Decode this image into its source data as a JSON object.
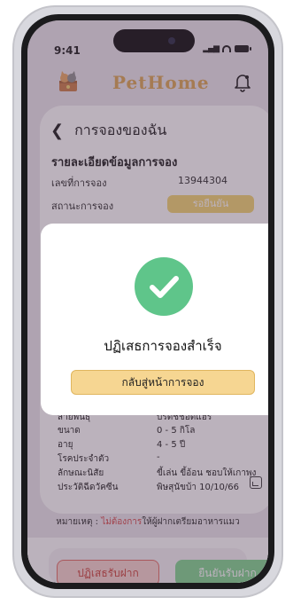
{
  "status_bar": {
    "time": "9:41"
  },
  "header": {
    "brand": "PetHome"
  },
  "booking": {
    "page_title": "การจองของฉัน",
    "section_title": "รายละเอียดข้อมูลการจอง",
    "rows": [
      {
        "label": "เลขที่การจอง",
        "value": "13944304"
      },
      {
        "label": "สถานะการจอง",
        "value": "รอยืนยัน"
      }
    ]
  },
  "pet": {
    "rows": [
      {
        "label": "สายพันธุ์",
        "value": "บริติชช็อตแฮร์"
      },
      {
        "label": "ขนาด",
        "value": "0 - 5 กิโล"
      },
      {
        "label": "อายุ",
        "value": "4 - 5 ปี"
      },
      {
        "label": "โรคประจำตัว",
        "value": "-"
      },
      {
        "label": "ลักษณะนิสัย",
        "value": "ขี้เล่น ขี้อ้อน ชอบให้เกาพุง"
      },
      {
        "label": "ประวัติฉีดวัคซีน",
        "value": "พิษสุนัขบ้า  10/10/66"
      }
    ],
    "vaccine_icon": "document-icon"
  },
  "remark": {
    "prefix": "หมายเหตุ : ",
    "highlight": "ไม่ต้องการ",
    "suffix": "ให้ผู้ฝากเตรียมอาหารแมว"
  },
  "actions": {
    "reject_label": "ปฏิเสธรับฝาก",
    "accept_label": "ยืนยันรับฝาก"
  },
  "modal": {
    "title": "ปฏิเสธการจองสำเร็จ",
    "button_label": "กลับสู่หน้าการจอง",
    "icon": "check-icon"
  },
  "colors": {
    "brand": "#d9a14a",
    "success": "#5fc58a",
    "status_pill": "#f2d36b",
    "reject": "#e2645b",
    "accept": "#7bd48b",
    "remark_highlight": "#d23b3b"
  }
}
